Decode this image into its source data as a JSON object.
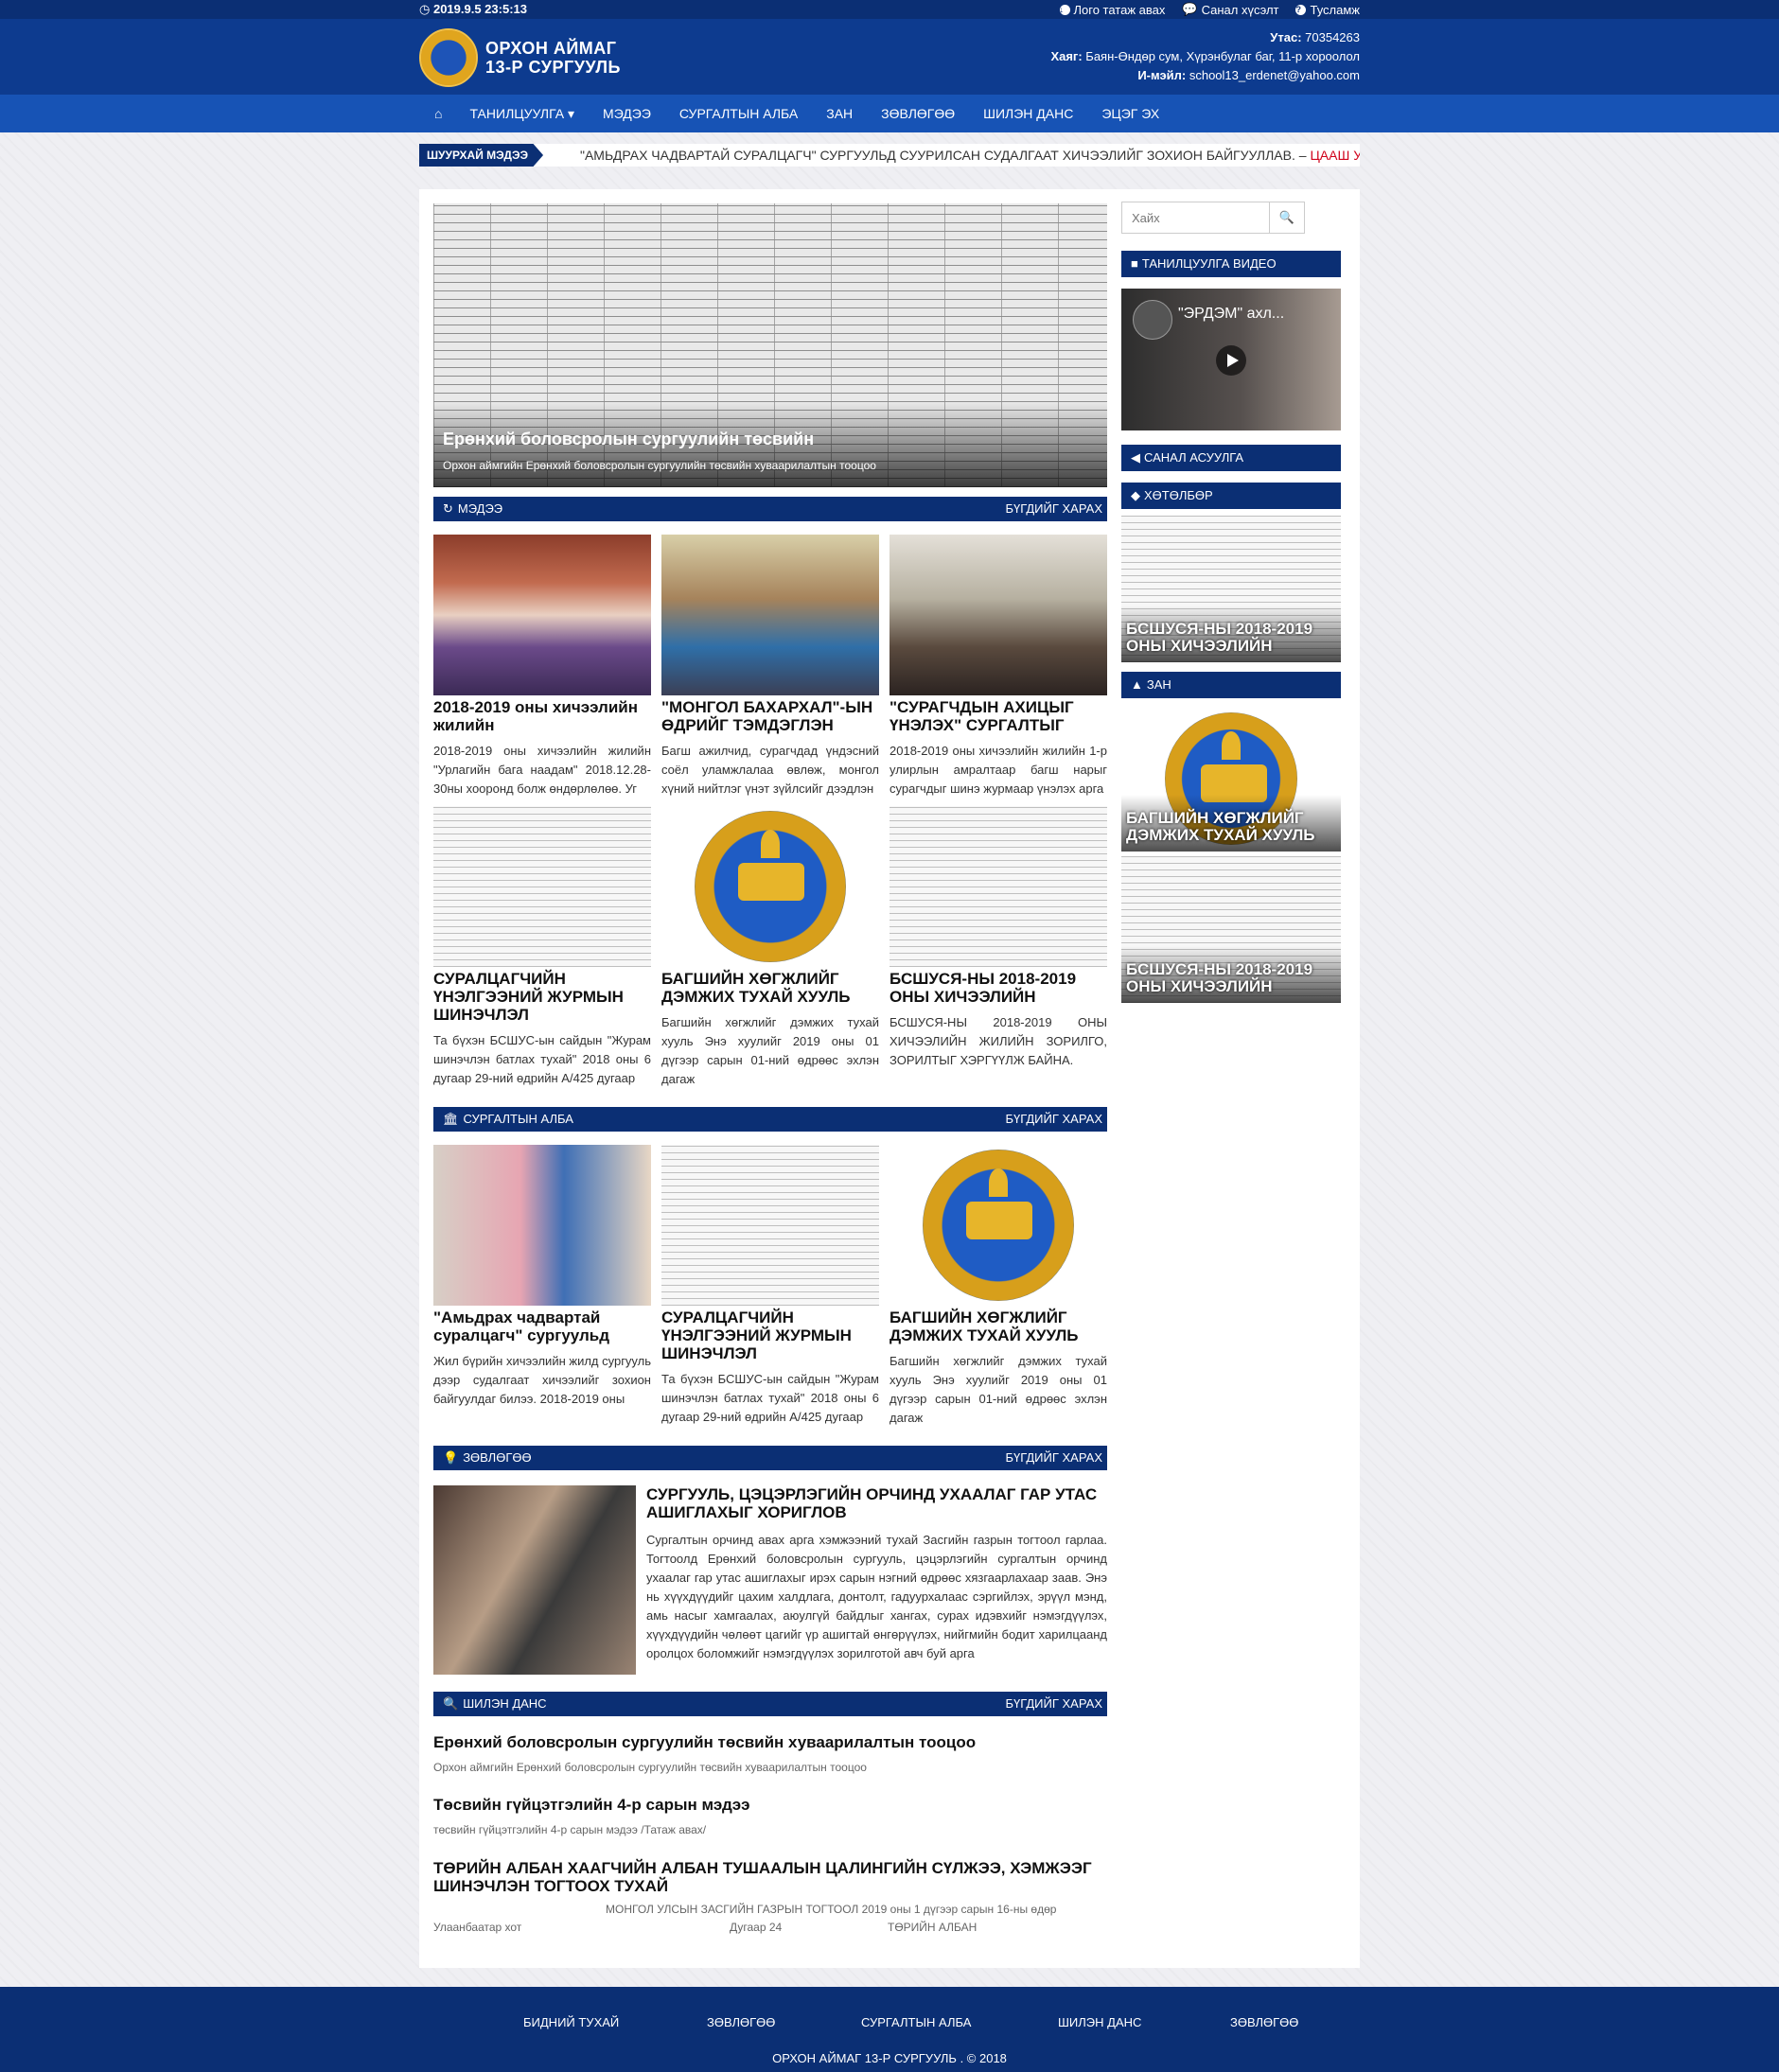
{
  "topbar": {
    "datetime": "2019.9.5 23:5:13",
    "links": [
      "Лого татаж авах",
      "Санал хүсэлт",
      "Тусламж"
    ]
  },
  "header": {
    "logo_line1": "ОРХОН АЙМАГ",
    "logo_line2": "13-Р СУРГУУЛЬ",
    "phone_label": "Утас:",
    "phone": "70354263",
    "address_label": "Хаяг:",
    "address": "Баян-Өндөр сум, Хүрэнбулаг баг, 11-р хороолол",
    "email_label": "И-мэйл:",
    "email": "school13_erdenet@yahoo.com"
  },
  "nav": {
    "items": [
      "ТАНИЛЦУУЛГА",
      "МЭДЭЭ",
      "СУРГАЛТЫН АЛБА",
      "ЗАН",
      "ЗӨВЛӨГӨӨ",
      "ШИЛЭН ДАНС",
      "ЭЦЭГ ЭХ"
    ]
  },
  "ticker": {
    "label": "ШУУРХАЙ МЭДЭЭ",
    "text": "\"АМЬДРАХ ЧАДВАРТАЙ СУРАЛЦАГЧ\" СУРГУУЛЬД СУУРИЛСАН СУДАЛГААТ ХИЧЭЭЛИЙГ ЗОХИОН БАЙГУУЛЛАВ. –",
    "more": "ЦААШ УНШИХ"
  },
  "hero": {
    "title": "Ерөнхий боловсролын сургуулийн төсвийн",
    "subtitle": "Орхон аймгийн Ерөнхий боловсролын сургуулийн төсвийн хуваарилалтын тооцоо"
  },
  "sections": {
    "news": {
      "label": "МЭДЭЭ",
      "more": "БҮГДИЙГ ХАРАХ"
    },
    "training": {
      "label": "СУРГАЛТЫН АЛБА",
      "more": "БҮГДИЙГ ХАРАХ"
    },
    "advice": {
      "label": "ЗӨВЛӨГӨӨ",
      "more": "БҮГДИЙГ ХАРАХ"
    },
    "accounts": {
      "label": "ШИЛЭН ДАНС",
      "more": "БҮГДИЙГ ХАРАХ"
    }
  },
  "news_cards": [
    {
      "title": "2018-2019 оны хичээлийн жилийн",
      "excerpt": "2018-2019 оны хичээлийн жилийн \"Урлагийн бага наадам\" 2018.12.28-30ны хооронд болж өндөрлөлөө. Уг"
    },
    {
      "title": "\"МОНГОЛ БАХАРХАЛ\"-ЫН ӨДРИЙГ ТЭМДЭГЛЭН",
      "excerpt": "Багш ажилчид, сурагчдад үндэсний соёл уламжлалаа өвлөж, монгол хүний нийтлэг үнэт зүйлсийг дээдлэн"
    },
    {
      "title": "\"СУРАГЧДЫН АХИЦЫГ ҮНЭЛЭХ\" СУРГАЛТЫГ",
      "excerpt": "2018-2019 оны хичээлийн жилийн 1-р улирлын амралтаар багш нарыг сурагчдыг шинэ журмаар үнэлэх арга"
    },
    {
      "title": "СУРАЛЦАГЧИЙН ҮНЭЛГЭЭНИЙ ЖУРМЫН ШИНЭЧЛЭЛ",
      "excerpt": "Та бүхэн БСШУС-ын сайдын \"Журам шинэчлэн батлах тухай\" 2018 оны 6 дугаар 29-ний өдрийн А/425 дугаар"
    },
    {
      "title": "БАГШИЙН ХӨГЖЛИЙГ ДЭМЖИХ ТУХАЙ ХУУЛЬ",
      "excerpt": "Багшийн хөгжлийг дэмжих тухай хууль Энэ хуулийг 2019 оны 01 дүгээр сарын 01-ний өдрөөс эхлэн дагаж"
    },
    {
      "title": "БСШУСЯ-НЫ 2018-2019 ОНЫ ХИЧЭЭЛИЙН",
      "excerpt": "БСШУСЯ-НЫ 2018-2019 ОНЫ ХИЧЭЭЛИЙН ЖИЛИЙН ЗОРИЛГО, ЗОРИЛТЫГ ХЭРГҮҮЛЖ БАЙНА."
    }
  ],
  "training_cards": [
    {
      "title": "\"Амьдрах чадвартай суралцагч\" сургуульд",
      "excerpt": "Жил бүрийн хичээлийн жилд сургууль дээр судалгаат хичээлийг зохион байгуулдаг билээ. 2018-2019 оны"
    },
    {
      "title": "СУРАЛЦАГЧИЙН ҮНЭЛГЭЭНИЙ ЖУРМЫН ШИНЭЧЛЭЛ",
      "excerpt": "Та бүхэн БСШУС-ын сайдын \"Журам шинэчлэн батлах тухай\" 2018 оны 6 дугаар 29-ний өдрийн А/425 дугаар"
    },
    {
      "title": "БАГШИЙН ХӨГЖЛИЙГ ДЭМЖИХ ТУХАЙ ХУУЛЬ",
      "excerpt": "Багшийн хөгжлийг дэмжих тухай хууль Энэ хуулийг 2019 оны 01 дүгээр сарын 01-ний өдрөөс эхлэн дагаж"
    }
  ],
  "advice": {
    "title": "СУРГУУЛЬ, ЦЭЦЭРЛЭГИЙН ОРЧИНД УХААЛАГ ГАР УТАС АШИГЛАХЫГ ХОРИГЛОВ",
    "text": "Сургалтын орчинд авах арга хэмжээний тухай Засгийн газрын тогтоол гарлаа. Тогтоолд Ерөнхий боловсролын сургууль, цэцэрлэгийн сургалтын орчинд ухаалаг гар утас ашиглахыг ирэх сарын нэгний өдрөөс хязгаарлахаар заав. Энэ нь хүүхдүүдийг цахим халдлага, донтолт, гадуурхалаас сэргийлэх, эрүүл мэнд, амь насыг хамгаалах, аюулгүй байдлыг хангах, сурах идэвхийг нэмэгдүүлэх, хүүхдүүдийн чөлөөт цагийг үр ашигтай өнгөрүүлэх, нийгмийн бодит харилцаанд оролцох боломжийг нэмэгдүүлэх зорилготой авч буй арга"
  },
  "accounts": [
    {
      "title": "Ерөнхий боловсролын сургуулийн төсвийн хуваарилалтын тооцоо",
      "sub": "Орхон аймгийн Ерөнхий боловсролын сургуулийн төсвийн хуваарилалтын тооцоо"
    },
    {
      "title": "Төсвийн гүйцэтгэлийн 4-р сарын мэдээ",
      "sub": "төсвийн гүйцэтгэлийн 4-р сарын мэдээ /Татаж авах/"
    },
    {
      "title": "ТӨРИЙН АЛБАН ХААГЧИЙН АЛБАН ТУШААЛЫН ЦАЛИНГИЙН СҮЛЖЭЭ, ХЭМЖЭЭГ ШИНЭЧЛЭН ТОГТООХ ТУХАЙ",
      "line1": "МОНГОЛ УЛСЫН ЗАСГИЙН ГАЗРЫН ТОГТООЛ 2019 оны 1 дүгээр сарын 16-ны өдөр",
      "city": "Улаанбаатар хот",
      "num": "Дугаар 24",
      "org": "ТӨРИЙН АЛБАН"
    }
  ],
  "sidebar": {
    "search_placeholder": "Хайх",
    "video_label": "ТАНИЛЦУУЛГА ВИДЕО",
    "video_title": "\"ЭРДЭМ\" ахл...",
    "survey_label": "САНАЛ АСУУЛГА",
    "program_label": "ХӨТӨЛБӨР",
    "program_caption": "БСШУСЯ-НЫ 2018-2019 ОНЫ ХИЧЭЭЛИЙН",
    "zan_label": "ЗАН",
    "zan_caption1": "БАГШИЙН ХӨГЖЛИЙГ ДЭМЖИХ ТУХАЙ ХУУЛЬ",
    "zan_caption2": "БСШУСЯ-НЫ 2018-2019 ОНЫ ХИЧЭЭЛИЙН"
  },
  "footer": {
    "links": [
      "БИДНИЙ ТУХАЙ",
      "ЗӨВЛӨГӨӨ",
      "СУРГАЛТЫН АЛБА",
      "ШИЛЭН ДАНС",
      "ЗӨВЛӨГӨӨ"
    ],
    "copyright": "ОРХОН АЙМАГ 13-Р СУРГУУЛЬ . © 2018"
  },
  "colors": {
    "dark_blue": "#0b2f74",
    "blue": "#1753b5",
    "accent_red": "#d0021b"
  }
}
